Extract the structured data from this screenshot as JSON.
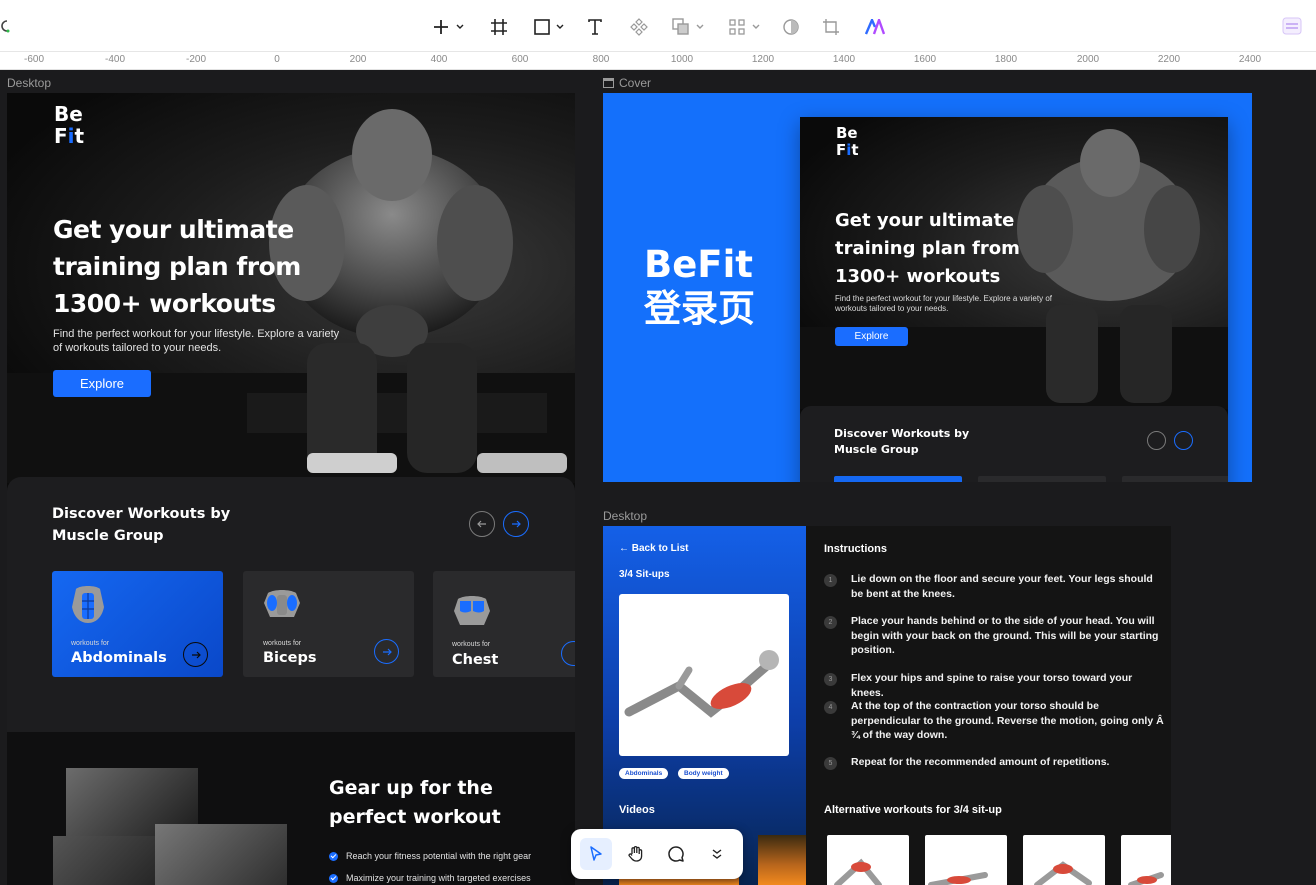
{
  "toolbar": {
    "tools": [
      "add-icon",
      "frame-icon",
      "shape-icon",
      "text-icon",
      "component-icon",
      "boolean-icon",
      "align-icon",
      "mask-icon",
      "crop-icon",
      "ai-plugin-icon"
    ]
  },
  "ruler": {
    "ticks": [
      "-600",
      "-400",
      "-200",
      "0",
      "200",
      "400",
      "600",
      "800",
      "1000",
      "1200",
      "1400",
      "1600",
      "1800",
      "2000",
      "2200",
      "2400"
    ]
  },
  "frames": {
    "desktop_label": "Desktop",
    "cover_label": "Cover",
    "detail_label": "Desktop"
  },
  "landing": {
    "logo_be": "Be",
    "logo_f": "F",
    "logo_i": "i",
    "logo_t": "t",
    "hero_title": "Get your ultimate training plan from 1300+ workouts",
    "hero_subtitle": "Find the perfect workout for your lifestyle. Explore a variety of workouts tailored to your needs.",
    "explore_button": "Explore",
    "discover_title": "Discover Workouts by Muscle Group",
    "cards": [
      {
        "small": "workouts for",
        "name": "Abdominals"
      },
      {
        "small": "workouts for",
        "name": "Biceps"
      },
      {
        "small": "workouts for",
        "name": "Chest"
      }
    ],
    "gear_title": "Gear up for the perfect workout",
    "gear_points": [
      "Reach your fitness potential with the right gear",
      "Maximize your training with targeted exercises"
    ]
  },
  "cover": {
    "title_line1": "BeFit",
    "title_line2": "登录页",
    "mini_hero_title": "Get your ultimate training plan from 1300+ workouts",
    "mini_hero_subtitle": "Find the perfect workout for your lifestyle. Explore a variety of workouts tailored to your needs.",
    "mini_explore": "Explore",
    "mini_discover_title": "Discover Workouts by Muscle Group"
  },
  "detail": {
    "back_link": "← Back to List",
    "exercise_title": "3/4 Sit-ups",
    "tags": [
      "Abdominals",
      "Body weight"
    ],
    "videos_label": "Videos",
    "instructions_title": "Instructions",
    "steps": [
      {
        "num": "1",
        "text": "Lie down on the floor and secure your feet. Your legs should be bent at the knees."
      },
      {
        "num": "2",
        "text": "Place your hands behind or to the side of your head. You will begin with your back on the ground. This will be your starting position."
      },
      {
        "num": "3",
        "text": "Flex your hips and spine to raise your torso toward your knees."
      },
      {
        "num": "4",
        "text": "At the top of the contraction your torso should be perpendicular to the ground. Reverse the motion, going only Â ¾ of the way down."
      },
      {
        "num": "5",
        "text": "Repeat for the recommended amount of repetitions."
      }
    ],
    "alt_title": "Alternative workouts for 3/4 sit-up"
  },
  "colors": {
    "accent": "#1a6dff",
    "cover_bg": "#1470fb",
    "card_dark": "#2a2a2c",
    "page_bg": "#1b1b1d"
  },
  "float_toolbar": [
    "pointer-icon",
    "hand-icon",
    "comment-icon",
    "more-chevron-icon"
  ]
}
